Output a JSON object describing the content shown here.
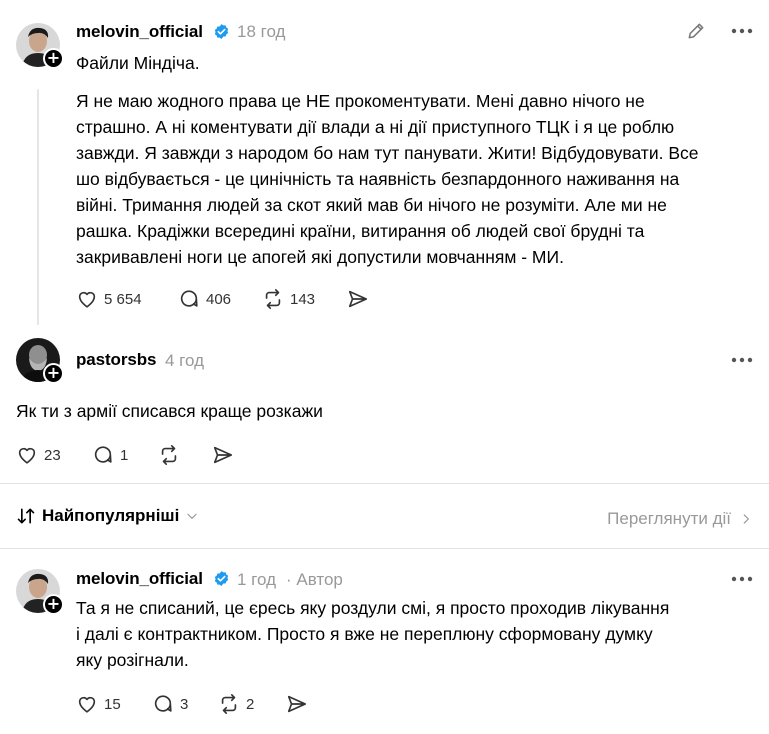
{
  "post": {
    "username": "melovin_official",
    "time": "18 год",
    "title": "Файли Міндіча.",
    "body": "Я не маю жодного права це НЕ прокоментувати. Мені давно нічого не\nстрашно. А ні коментувати дії влади а ні дії приступного ТЦК і я це роблю\nзавжди. Я завжди з народом бо нам тут панувати. Жити! Відбудовувати. Все\nшо відбувається - це цинічність та наявність безпардонного наживання на\nвійні. Тримання людей за скот який мав би нічого не розуміти. Але ми не\nрашка. Крадіжки всередині країни, витирання об людей свої брудні та\nзакривавлені ноги це апогей які допустили мовчанням - МИ.",
    "likes": "5 654",
    "comments": "406",
    "reposts": "143"
  },
  "reply": {
    "username": "pastorsbs",
    "time": "4 год",
    "body": "Як ти з армії списався краще розкажи",
    "likes": "23",
    "comments": "1"
  },
  "sort": {
    "label": "Найпопулярніші",
    "view_activity": "Переглянути дії"
  },
  "author_reply": {
    "username": "melovin_official",
    "time": "1 год",
    "author_tag": "· Автор",
    "body": "Та я не списаний, це єресь яку роздули смі, я просто проходив лікування\nі далі є контрактником. Просто я вже не переплюну сформовану думку\nяку розігнали.",
    "likes": "15",
    "comments": "3",
    "reposts": "2"
  },
  "icons": {
    "verified": "verified-badge-icon",
    "edit": "pencil-icon",
    "more": "more-icon",
    "like": "heart-icon",
    "comment": "comment-icon",
    "repost": "repost-icon",
    "share": "send-icon",
    "sort": "sort-arrows-icon",
    "chevron_down": "chevron-down-icon",
    "chevron_right": "chevron-right-icon"
  },
  "colors": {
    "verified": "#1d9bf0",
    "muted": "#999999",
    "divider": "#e3e3e3"
  }
}
